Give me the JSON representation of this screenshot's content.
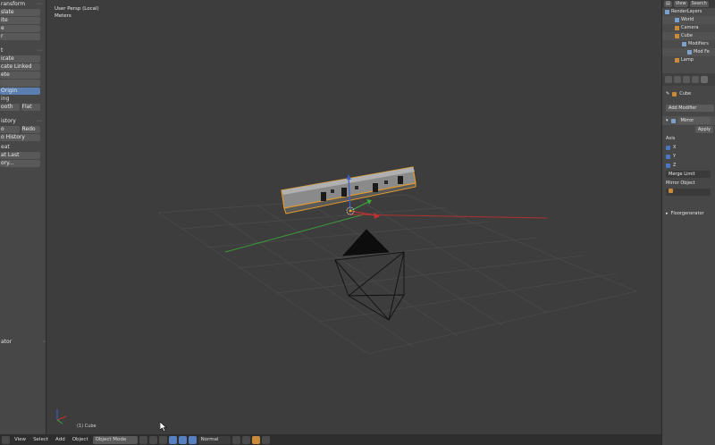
{
  "tool_shelf": {
    "transform_title": "ransform",
    "translate": "slate",
    "rotate": "ite",
    "scale": "e",
    "mirror": "r",
    "edit_title": "t",
    "duplicate": "icate",
    "duplicate_linked": "cate Linked",
    "delete": "ete",
    "join": "",
    "set_origin": "Origin",
    "shading_title": "ing",
    "smooth": "ooth",
    "flat": "Flat",
    "history_title": "istory",
    "undo": "o",
    "redo": "Redo",
    "undo_history": "o History",
    "repeat_title": "eat",
    "repeat_last": "at Last",
    "repeat_history": "ory...",
    "bottom_title": "ator"
  },
  "viewport": {
    "view_name": "User Persp (Local)",
    "units": "Meters",
    "object_label": "(1) Cube"
  },
  "header_bar": {
    "view": "View",
    "select": "Select",
    "add": "Add",
    "object": "Object",
    "mode": "Object Mode",
    "pivot": "Normal"
  },
  "outliner": {
    "tab_view": "View",
    "tab_search": "Search",
    "rows": [
      {
        "label": "RenderLayers",
        "icon": "render-layers-icon"
      },
      {
        "label": "World",
        "icon": "world-icon"
      },
      {
        "label": "Camera",
        "icon": "camera-icon"
      },
      {
        "label": "Cube",
        "icon": "cube-icon"
      },
      {
        "label": "Modifiers",
        "icon": "modifier-icon"
      },
      {
        "label": "Mod Fe",
        "icon": "modifier-icon"
      },
      {
        "label": "Lamp",
        "icon": "lamp-icon"
      }
    ]
  },
  "properties": {
    "object_name": "Cube",
    "add_modifier": "Add Modifier",
    "modifier_name": "Mirror",
    "apply": "Apply",
    "axis_label": "Axis",
    "x": "X",
    "y": "Y",
    "z": "Z",
    "merge_limit": "Merge Limit",
    "mirror_object": "Mirror Object",
    "panel_title": "Floorgenerator"
  },
  "colors": {
    "background": "#3d3d3d",
    "axis_x": "#b03030",
    "axis_y": "#3a9a3a",
    "accent": "#5680c2",
    "selection": "#e39a2a"
  }
}
